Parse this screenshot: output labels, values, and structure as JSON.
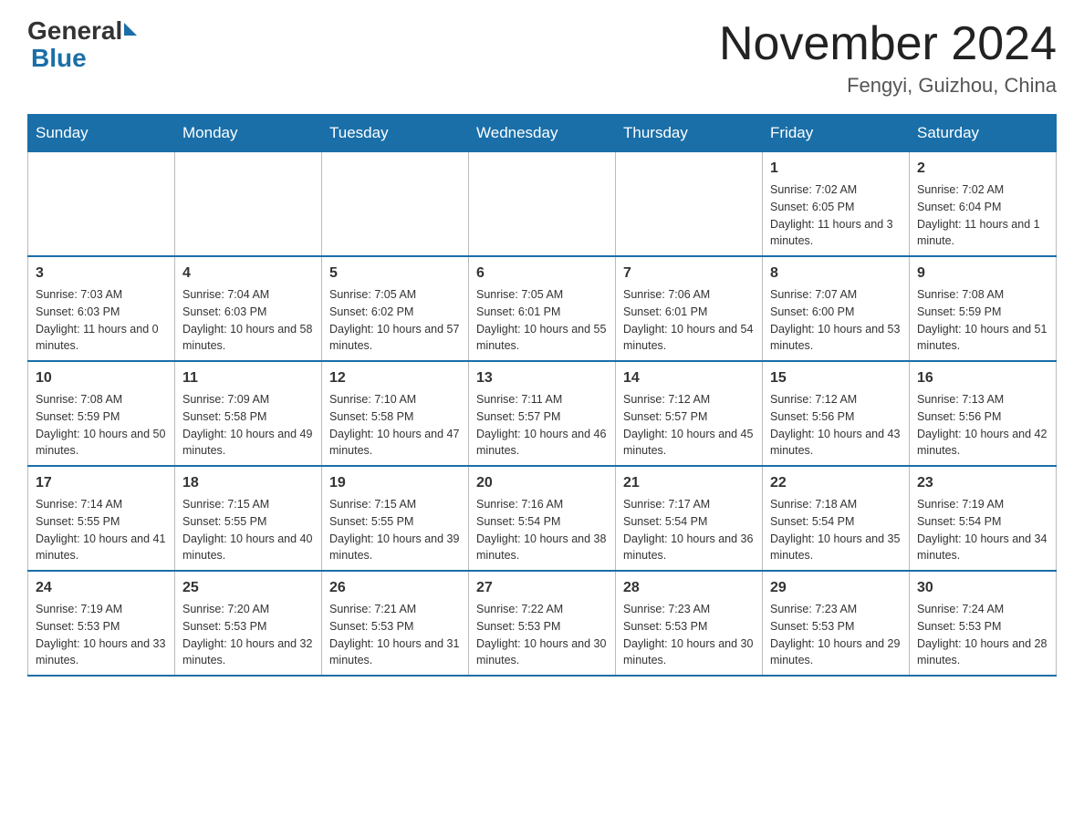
{
  "header": {
    "logo_general": "General",
    "logo_blue": "Blue",
    "title": "November 2024",
    "subtitle": "Fengyi, Guizhou, China"
  },
  "weekdays": [
    "Sunday",
    "Monday",
    "Tuesday",
    "Wednesday",
    "Thursday",
    "Friday",
    "Saturday"
  ],
  "weeks": [
    [
      {
        "day": "",
        "info": ""
      },
      {
        "day": "",
        "info": ""
      },
      {
        "day": "",
        "info": ""
      },
      {
        "day": "",
        "info": ""
      },
      {
        "day": "",
        "info": ""
      },
      {
        "day": "1",
        "info": "Sunrise: 7:02 AM\nSunset: 6:05 PM\nDaylight: 11 hours and 3 minutes."
      },
      {
        "day": "2",
        "info": "Sunrise: 7:02 AM\nSunset: 6:04 PM\nDaylight: 11 hours and 1 minute."
      }
    ],
    [
      {
        "day": "3",
        "info": "Sunrise: 7:03 AM\nSunset: 6:03 PM\nDaylight: 11 hours and 0 minutes."
      },
      {
        "day": "4",
        "info": "Sunrise: 7:04 AM\nSunset: 6:03 PM\nDaylight: 10 hours and 58 minutes."
      },
      {
        "day": "5",
        "info": "Sunrise: 7:05 AM\nSunset: 6:02 PM\nDaylight: 10 hours and 57 minutes."
      },
      {
        "day": "6",
        "info": "Sunrise: 7:05 AM\nSunset: 6:01 PM\nDaylight: 10 hours and 55 minutes."
      },
      {
        "day": "7",
        "info": "Sunrise: 7:06 AM\nSunset: 6:01 PM\nDaylight: 10 hours and 54 minutes."
      },
      {
        "day": "8",
        "info": "Sunrise: 7:07 AM\nSunset: 6:00 PM\nDaylight: 10 hours and 53 minutes."
      },
      {
        "day": "9",
        "info": "Sunrise: 7:08 AM\nSunset: 5:59 PM\nDaylight: 10 hours and 51 minutes."
      }
    ],
    [
      {
        "day": "10",
        "info": "Sunrise: 7:08 AM\nSunset: 5:59 PM\nDaylight: 10 hours and 50 minutes."
      },
      {
        "day": "11",
        "info": "Sunrise: 7:09 AM\nSunset: 5:58 PM\nDaylight: 10 hours and 49 minutes."
      },
      {
        "day": "12",
        "info": "Sunrise: 7:10 AM\nSunset: 5:58 PM\nDaylight: 10 hours and 47 minutes."
      },
      {
        "day": "13",
        "info": "Sunrise: 7:11 AM\nSunset: 5:57 PM\nDaylight: 10 hours and 46 minutes."
      },
      {
        "day": "14",
        "info": "Sunrise: 7:12 AM\nSunset: 5:57 PM\nDaylight: 10 hours and 45 minutes."
      },
      {
        "day": "15",
        "info": "Sunrise: 7:12 AM\nSunset: 5:56 PM\nDaylight: 10 hours and 43 minutes."
      },
      {
        "day": "16",
        "info": "Sunrise: 7:13 AM\nSunset: 5:56 PM\nDaylight: 10 hours and 42 minutes."
      }
    ],
    [
      {
        "day": "17",
        "info": "Sunrise: 7:14 AM\nSunset: 5:55 PM\nDaylight: 10 hours and 41 minutes."
      },
      {
        "day": "18",
        "info": "Sunrise: 7:15 AM\nSunset: 5:55 PM\nDaylight: 10 hours and 40 minutes."
      },
      {
        "day": "19",
        "info": "Sunrise: 7:15 AM\nSunset: 5:55 PM\nDaylight: 10 hours and 39 minutes."
      },
      {
        "day": "20",
        "info": "Sunrise: 7:16 AM\nSunset: 5:54 PM\nDaylight: 10 hours and 38 minutes."
      },
      {
        "day": "21",
        "info": "Sunrise: 7:17 AM\nSunset: 5:54 PM\nDaylight: 10 hours and 36 minutes."
      },
      {
        "day": "22",
        "info": "Sunrise: 7:18 AM\nSunset: 5:54 PM\nDaylight: 10 hours and 35 minutes."
      },
      {
        "day": "23",
        "info": "Sunrise: 7:19 AM\nSunset: 5:54 PM\nDaylight: 10 hours and 34 minutes."
      }
    ],
    [
      {
        "day": "24",
        "info": "Sunrise: 7:19 AM\nSunset: 5:53 PM\nDaylight: 10 hours and 33 minutes."
      },
      {
        "day": "25",
        "info": "Sunrise: 7:20 AM\nSunset: 5:53 PM\nDaylight: 10 hours and 32 minutes."
      },
      {
        "day": "26",
        "info": "Sunrise: 7:21 AM\nSunset: 5:53 PM\nDaylight: 10 hours and 31 minutes."
      },
      {
        "day": "27",
        "info": "Sunrise: 7:22 AM\nSunset: 5:53 PM\nDaylight: 10 hours and 30 minutes."
      },
      {
        "day": "28",
        "info": "Sunrise: 7:23 AM\nSunset: 5:53 PM\nDaylight: 10 hours and 30 minutes."
      },
      {
        "day": "29",
        "info": "Sunrise: 7:23 AM\nSunset: 5:53 PM\nDaylight: 10 hours and 29 minutes."
      },
      {
        "day": "30",
        "info": "Sunrise: 7:24 AM\nSunset: 5:53 PM\nDaylight: 10 hours and 28 minutes."
      }
    ]
  ]
}
